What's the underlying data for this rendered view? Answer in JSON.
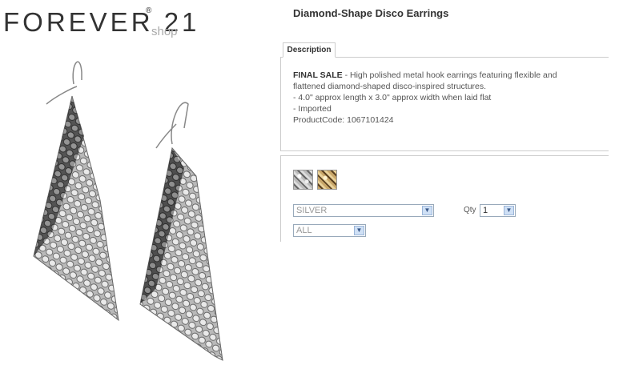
{
  "brand": {
    "name": "FOREVER 21",
    "registered": "®",
    "suffix": "shop"
  },
  "product": {
    "title": "Diamond-Shape Disco Earrings",
    "image_icon": "earrings-image"
  },
  "description": {
    "tab_label": "Description",
    "final_sale_label": "FINAL SALE",
    "line1_rest": " - High polished metal hook earrings featuring flexible and",
    "line2": "flattened diamond-shaped disco-inspired structures.",
    "line3": "- 4.0\" approx length x 3.0\" approx width when laid flat",
    "line4": "- Imported",
    "line5": "ProductCode: 1067101424"
  },
  "options": {
    "swatches": [
      {
        "name": "silver",
        "color": "#b0b0b0"
      },
      {
        "name": "gold",
        "color": "#c9a76a"
      }
    ],
    "color_select": {
      "value": "SILVER"
    },
    "size_select": {
      "value": "ALL"
    },
    "qty_label": "Qty",
    "qty_select": {
      "value": "1"
    }
  }
}
